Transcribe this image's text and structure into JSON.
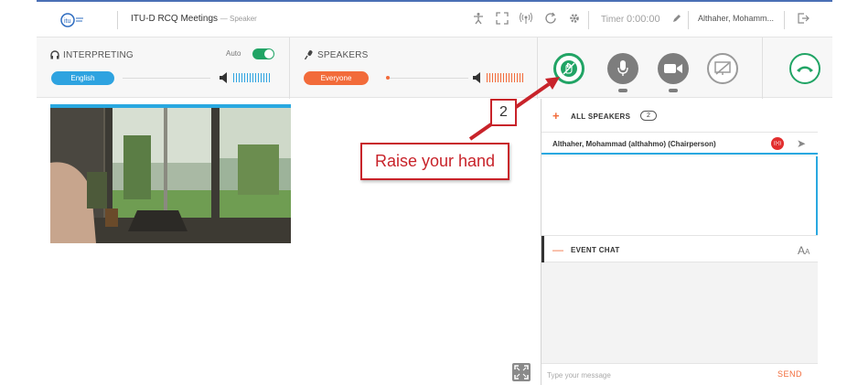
{
  "colors": {
    "accent_blue": "#29a8e0",
    "brand_green": "#21a465",
    "orange": "#f26b3a",
    "annotation_red": "#c8232a"
  },
  "topbar": {
    "title": "ITU-D RCQ Meetings",
    "title_suffix": "— Speaker",
    "timer_label": "Timer",
    "timer_value": "0:00:00",
    "user_name": "Althaher, Mohamm...",
    "icons": [
      "accessibility-icon",
      "fullscreen-icon",
      "broadcast-icon",
      "refresh-icon",
      "settings-icon",
      "edit-icon",
      "logout-icon"
    ]
  },
  "interpreting": {
    "label": "INTERPRETING",
    "language": "English",
    "auto_label": "Auto",
    "auto_enabled": true
  },
  "speakers_ctl": {
    "label": "SPEAKERS",
    "audience": "Everyone"
  },
  "controls": [
    "raise-hand",
    "microphone",
    "camera",
    "screen-share",
    "hang-up"
  ],
  "speakers_panel": {
    "title": "ALL SPEAKERS",
    "count": "2",
    "items": [
      {
        "name": "Althaher, Mohammad (althahmo) (Chairperson)"
      }
    ]
  },
  "chat": {
    "title": "EVENT CHAT",
    "font_icon_label": "AA",
    "placeholder": "Type your message",
    "send_label": "SEND"
  },
  "annotation": {
    "step_number": "2",
    "text": "Raise your hand"
  }
}
